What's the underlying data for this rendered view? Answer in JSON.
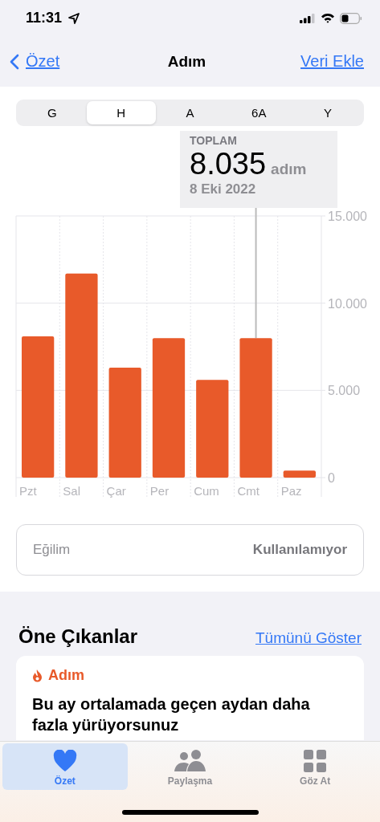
{
  "status_bar": {
    "time": "11:31"
  },
  "nav": {
    "back": "Özet",
    "title": "Adım",
    "action": "Veri Ekle"
  },
  "segments": [
    {
      "label": "G",
      "selected": false
    },
    {
      "label": "H",
      "selected": true
    },
    {
      "label": "A",
      "selected": false
    },
    {
      "label": "6A",
      "selected": false
    },
    {
      "label": "Y",
      "selected": false
    }
  ],
  "tooltip": {
    "label": "TOPLAM",
    "value": "8.035",
    "unit": "adım",
    "date": "8 Eki 2022"
  },
  "chart_data": {
    "type": "bar",
    "categories": [
      "Pzt",
      "Sal",
      "Çar",
      "Per",
      "Cum",
      "Cmt",
      "Paz"
    ],
    "series": [
      {
        "color": "#e85a2a",
        "values": [
          8100,
          11700,
          6300,
          8000,
          5600,
          8000,
          400
        ]
      }
    ],
    "ylim": [
      0,
      15000
    ],
    "yticks": [
      {
        "value": 0,
        "label": "0"
      },
      {
        "value": 5000,
        "label": "5.000"
      },
      {
        "value": 10000,
        "label": "10.000"
      },
      {
        "value": 15000,
        "label": "15.000"
      }
    ]
  },
  "trend": {
    "label": "Eğilim",
    "value": "Kullanılamıyor"
  },
  "highlights": {
    "title": "Öne Çıkanlar",
    "link": "Tümünü Göster",
    "card": {
      "category": "Adım",
      "text": "Bu ay ortalamada geçen aydan daha fazla yürüyorsunuz"
    }
  },
  "tab_bar": [
    {
      "label": "Özet",
      "kind": "heart",
      "selected": true
    },
    {
      "label": "Paylaşma",
      "kind": "people",
      "selected": false
    },
    {
      "label": "Göz At",
      "kind": "grid",
      "selected": false
    }
  ]
}
